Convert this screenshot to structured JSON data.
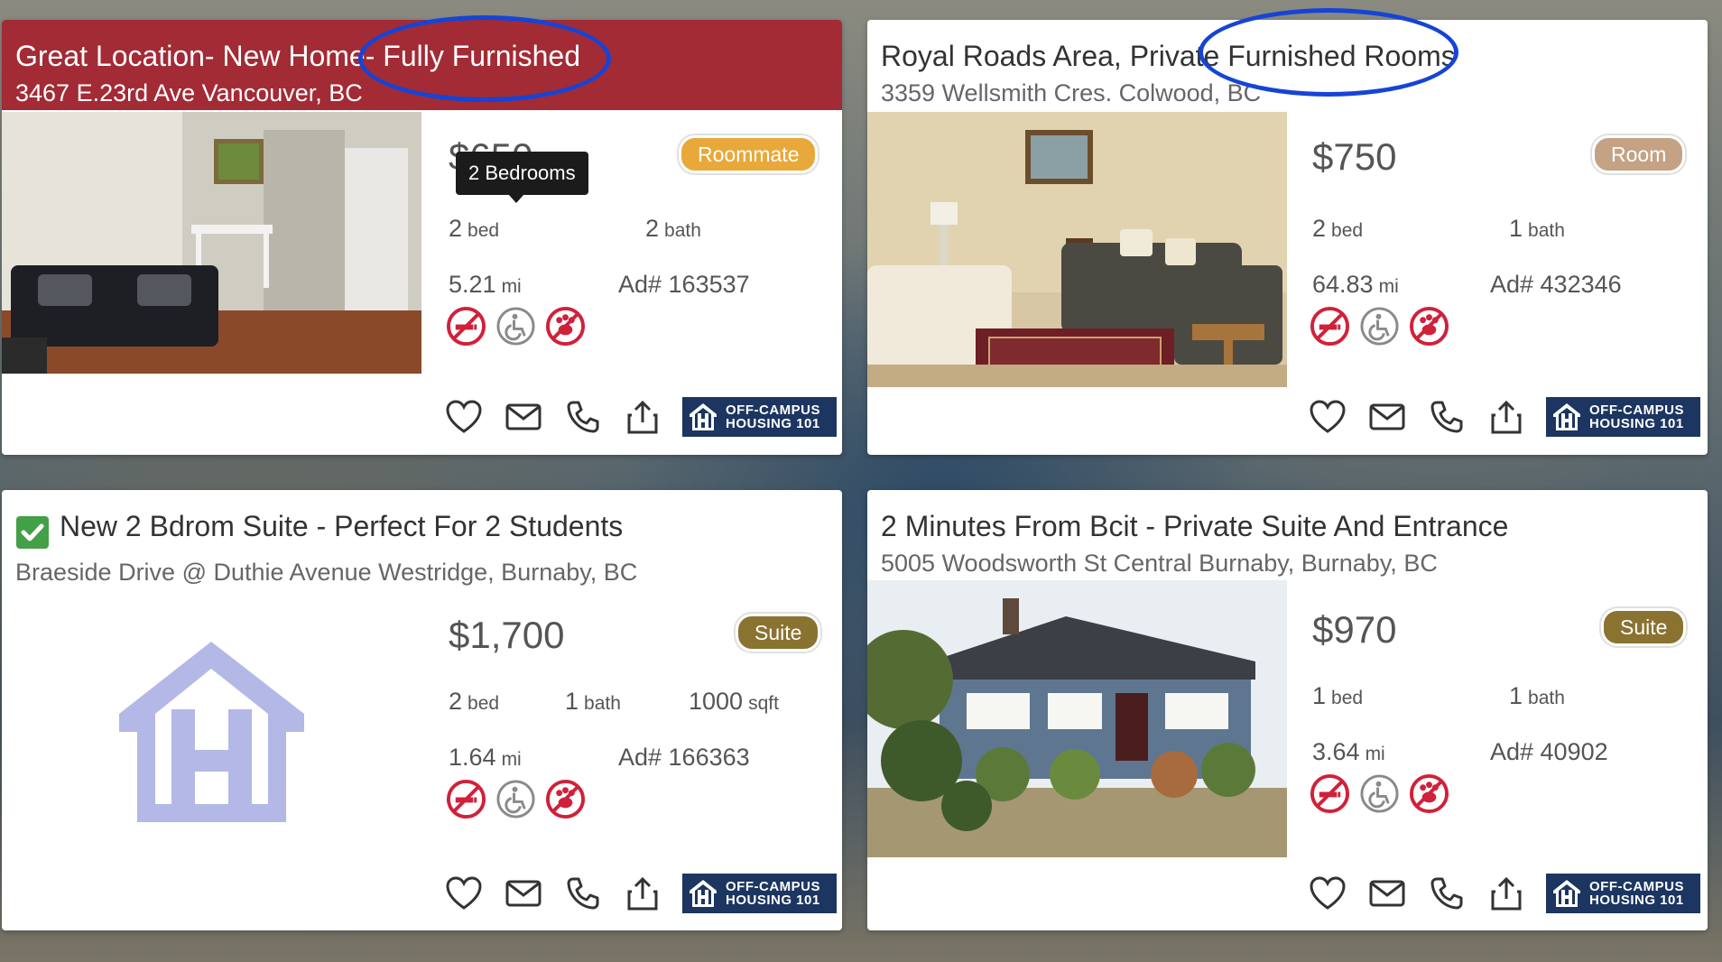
{
  "listings": [
    {
      "title": "Great Location- New Home- Fully Furnished",
      "address": "3467 E.23rd Ave Vancouver, BC",
      "price": "$650",
      "badge": "Roommate",
      "badge_color": "#e8a93a",
      "bed": "2",
      "bed_unit": "bed",
      "bath": "2",
      "bath_unit": "bath",
      "distance": "5.21",
      "distance_unit": "mi",
      "ad": "Ad# 163537",
      "tooltip": "2 Bedrooms"
    },
    {
      "title": "Royal Roads Area, Private Furnished Rooms",
      "address": "3359 Wellsmith Cres. Colwood, BC",
      "price": "$750",
      "badge": "Room",
      "badge_color": "#c4a283",
      "bed": "2",
      "bed_unit": "bed",
      "bath": "1",
      "bath_unit": "bath",
      "distance": "64.83",
      "distance_unit": "mi",
      "ad": "Ad# 432346"
    },
    {
      "title": "New 2 Bdrom Suite - Perfect For 2 Students",
      "address": "Braeside Drive @ Duthie Avenue Westridge, Burnaby, BC",
      "price": "$1,700",
      "badge": "Suite",
      "badge_color": "#8a7230",
      "bed": "2",
      "bed_unit": "bed",
      "bath": "1",
      "bath_unit": "bath",
      "sqft": "1000",
      "sqft_unit": "sqft",
      "distance": "1.64",
      "distance_unit": "mi",
      "ad": "Ad# 166363",
      "verified": true
    },
    {
      "title": "2 Minutes From Bcit - Private Suite And Entrance",
      "address": "5005 Woodsworth St Central Burnaby, Burnaby, BC",
      "price": "$970",
      "badge": "Suite",
      "badge_color": "#8a7230",
      "bed": "1",
      "bed_unit": "bed",
      "bath": "1",
      "bath_unit": "bath",
      "distance": "3.64",
      "distance_unit": "mi",
      "ad": "Ad# 40902"
    }
  ],
  "logo": {
    "line1": "OFF-CAMPUS",
    "line2": "HOUSING 101"
  },
  "colors": {
    "header_red": "#a22b35",
    "annotation_blue": "#1544d6",
    "amenity_red": "#d0213a",
    "logo_navy": "#1c3561"
  },
  "icons": [
    "no-smoking-icon",
    "wheelchair-icon",
    "no-pets-icon",
    "heart-icon",
    "mail-icon",
    "phone-icon",
    "share-icon"
  ]
}
